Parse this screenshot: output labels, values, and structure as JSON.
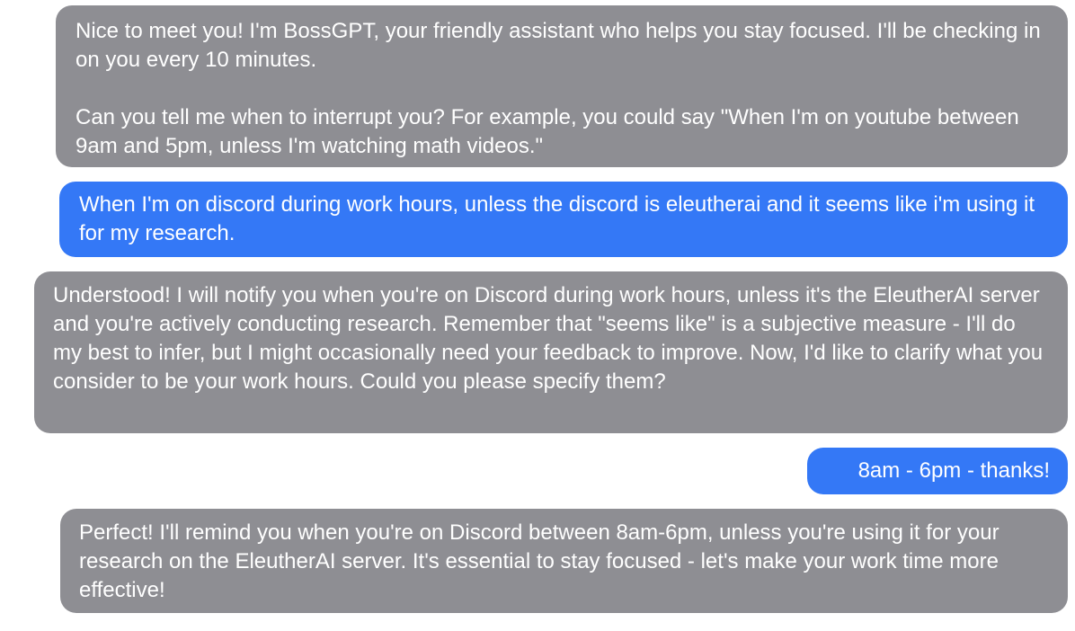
{
  "conversation": {
    "messages": [
      {
        "role": "assistant",
        "paragraphs": [
          "Nice to meet you! I'm BossGPT, your friendly assistant who helps you stay focused. I'll be checking in on you every 10 minutes.",
          "Can you tell me when to interrupt you? For example, you could say \"When I'm on youtube between 9am and 5pm, unless I'm watching math videos.\""
        ]
      },
      {
        "role": "user",
        "paragraphs": [
          "When I'm on discord during work hours, unless the discord is eleutherai and it seems like i'm using it for my research."
        ]
      },
      {
        "role": "assistant",
        "paragraphs": [
          "Understood! I will notify you when you're on Discord during work hours, unless it's the EleutherAI server and you're actively conducting research. Remember that \"seems like\" is a subjective measure - I'll do my best to infer, but I might occasionally need your feedback to improve. Now, I'd like to clarify what you consider to be your work hours. Could you please specify them?"
        ]
      },
      {
        "role": "user",
        "paragraphs": [
          "8am - 6pm - thanks!"
        ]
      },
      {
        "role": "assistant",
        "paragraphs": [
          "Perfect! I'll remind you when you're on Discord between 8am-6pm, unless you're using it for your research on the EleutherAI server. It's essential to stay focused - let's make your work time more effective!"
        ]
      }
    ]
  },
  "colors": {
    "assistant_bubble": "#8e8e93",
    "user_bubble": "#3478f6",
    "text": "#ffffff",
    "background": "#ffffff"
  }
}
